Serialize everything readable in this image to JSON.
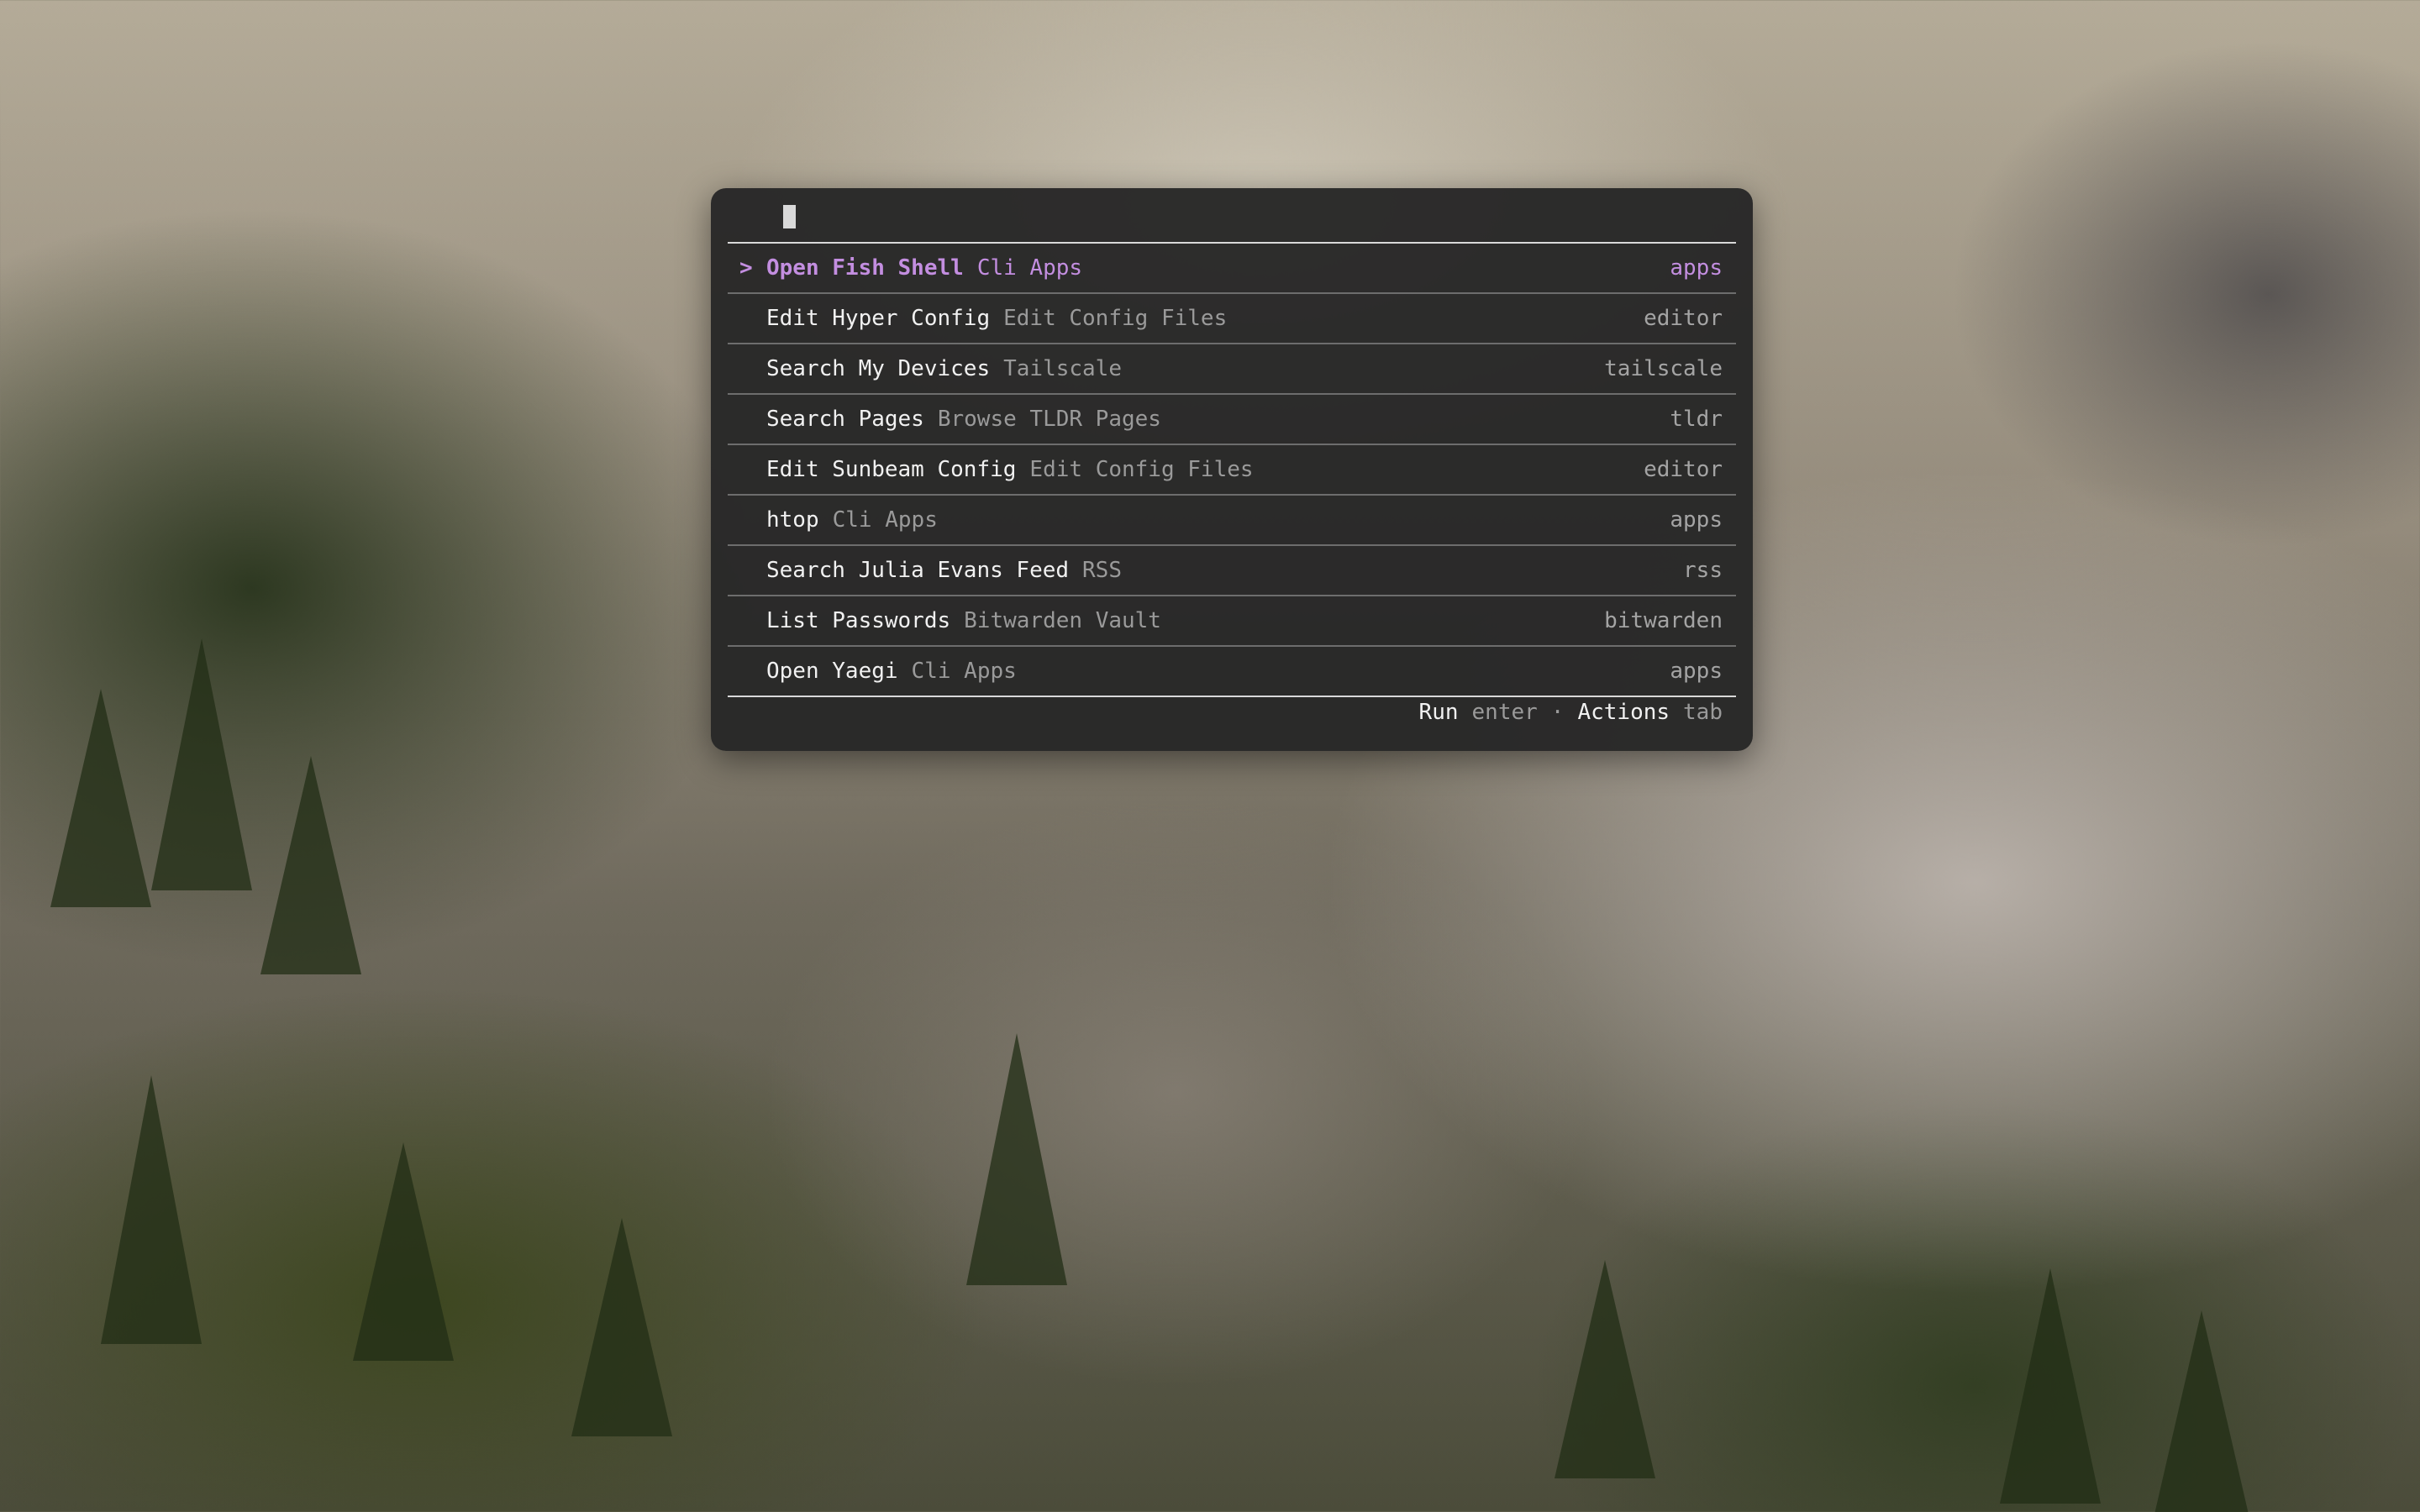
{
  "background": {
    "description_colors": {
      "mist": "#b4ab98",
      "forest": "#2f3a1f"
    }
  },
  "launcher": {
    "cursor_color": "#d9d9d9",
    "accent_color": "#c38ee0",
    "selected_marker": ">",
    "items": [
      {
        "title": "Open Fish Shell",
        "subtitle": "Cli Apps",
        "accessory": "apps"
      },
      {
        "title": "Edit Hyper Config",
        "subtitle": "Edit Config Files",
        "accessory": "editor"
      },
      {
        "title": "Search My Devices",
        "subtitle": "Tailscale",
        "accessory": "tailscale"
      },
      {
        "title": "Search Pages",
        "subtitle": "Browse TLDR Pages",
        "accessory": "tldr"
      },
      {
        "title": "Edit Sunbeam Config",
        "subtitle": "Edit Config Files",
        "accessory": "editor"
      },
      {
        "title": "htop",
        "subtitle": "Cli Apps",
        "accessory": "apps"
      },
      {
        "title": "Search Julia Evans Feed",
        "subtitle": "RSS",
        "accessory": "rss"
      },
      {
        "title": "List Passwords",
        "subtitle": "Bitwarden Vault",
        "accessory": "bitwarden"
      },
      {
        "title": "Open Yaegi",
        "subtitle": "Cli Apps",
        "accessory": "apps"
      }
    ],
    "footer": {
      "run_label": "Run",
      "run_key": "enter",
      "separator": "·",
      "actions_label": "Actions",
      "actions_key": "tab"
    }
  }
}
